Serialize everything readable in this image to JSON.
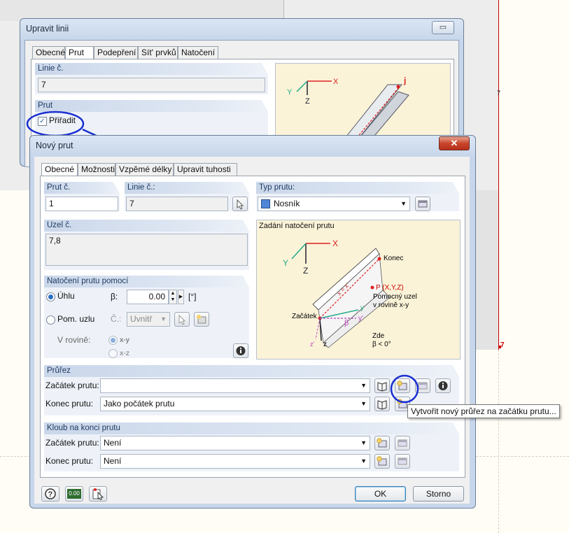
{
  "background": {
    "node_label_top": "7",
    "node_label_bottom": "7"
  },
  "upravit_linii": {
    "title": "Upravit linii",
    "minimize": "▭",
    "tabs": [
      "Obecné",
      "Prut",
      "Podepření",
      "Sít' prvků",
      "Natočení"
    ],
    "group_linie": "Linie č.",
    "linie_value": "7",
    "group_prut": "Prut",
    "assign_label": "Přiřadit",
    "assign_checked": true,
    "diagram_labels": {
      "x": "X",
      "y": "Y",
      "z": "Z",
      "j": "j"
    }
  },
  "novy_prut": {
    "title": "Nový prut",
    "close": "✕",
    "tabs": [
      "Obecné",
      "Možnosti",
      "Vzpěmé délky",
      "Upravit tuhosti"
    ],
    "prut_c_label": "Prut č.",
    "prut_c_value": "1",
    "linie_c_label": "Linie č.:",
    "linie_c_value": "7",
    "typ_prutu_label": "Typ prutu:",
    "typ_prutu_value": "Nosník",
    "typ_prutu_color": "#4f86d8",
    "uzel_label": "Uzel č.",
    "uzel_value": "7,8",
    "natoceni_group": "Natočení prutu pomocí",
    "uhlu_label": "Úhlu",
    "beta_label": "β:",
    "beta_value": "0.00",
    "beta_unit": "[°]",
    "pom_uzlu_label": "Pom. uzlu",
    "c_label": "Č.:",
    "uvnitr_value": "Uvnitř",
    "v_rovine_label": "V rovině:",
    "xy_label": "x-y",
    "xz_label": "x-z",
    "zadani_title": "Zadání natočení prutu",
    "diagram": {
      "X": "X",
      "Y": "Y",
      "Z": "Z",
      "konec": "Konec",
      "p_label": "P (X,Y,Z)",
      "pomocny": "Pomocný uzel",
      "v_rovine": "v rovině x-y",
      "zacatek": "Začátek",
      "zde": "Zde",
      "beta_cond": "β < 0°",
      "x_eq": "x = x'",
      "y": "y",
      "yp": "y'",
      "beta": "β",
      "zp": "z'",
      "z": "z"
    },
    "prurez_group": "Průřez",
    "zacatek_label": "Začátek prutu:",
    "zacatek_value": "",
    "konec_label": "Konec prutu:",
    "konec_value": "Jako počátek prutu",
    "kloub_group": "Kloub na konci prutu",
    "kloub_zacatek_label": "Začátek prutu:",
    "kloub_zacatek_value": "Není",
    "kloub_konec_label": "Konec prutu:",
    "kloub_konec_value": "Není",
    "ok_label": "OK",
    "storno_label": "Storno",
    "units_label": "0.00",
    "tooltip": "Vytvořit nový průřez na začátku prutu..."
  }
}
